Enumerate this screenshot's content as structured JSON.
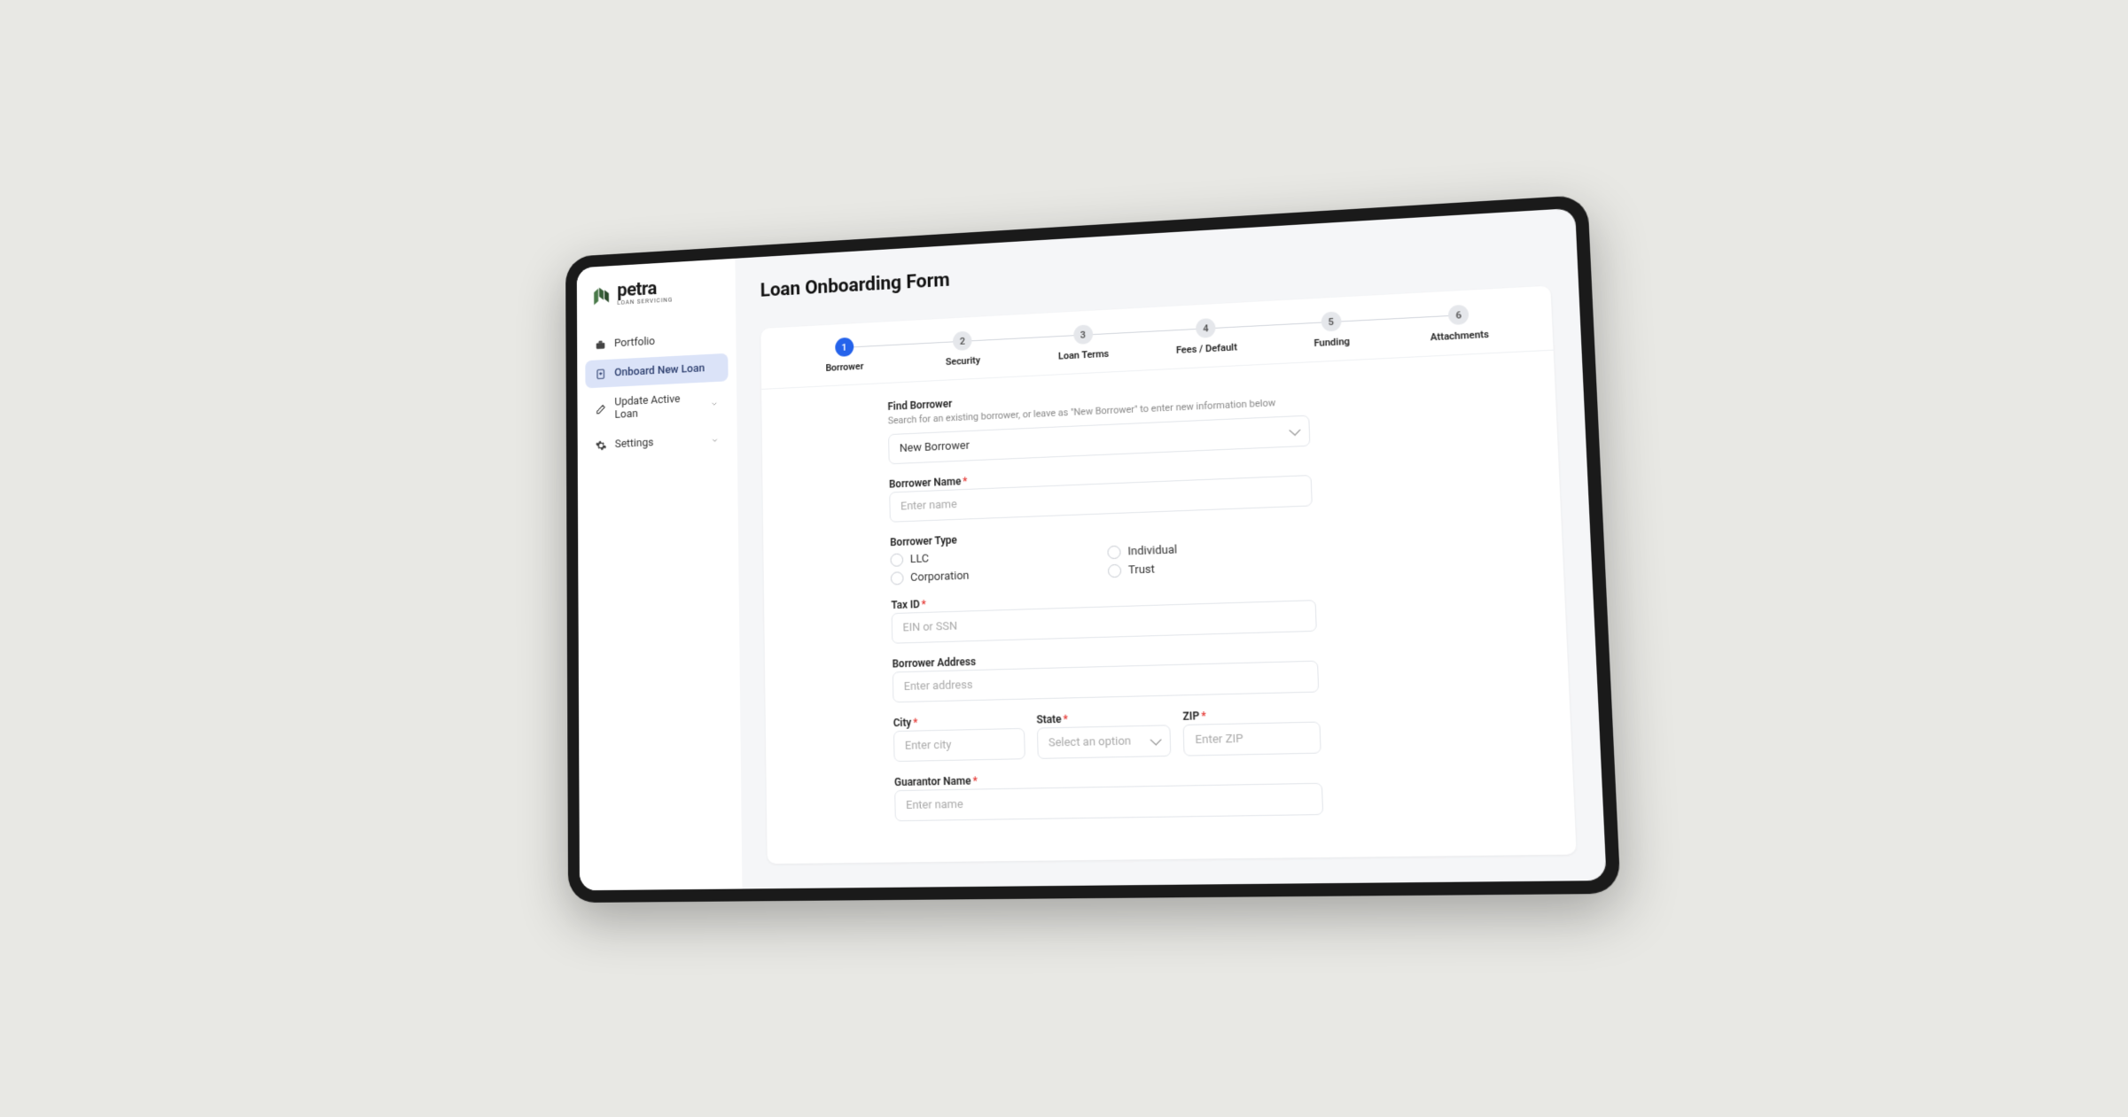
{
  "brand": {
    "name": "petra",
    "tagline": "LOAN SERVICING"
  },
  "nav": {
    "portfolio": "Portfolio",
    "onboard": "Onboard New Loan",
    "update": "Update Active Loan",
    "settings": "Settings"
  },
  "page": {
    "title": "Loan Onboarding Form"
  },
  "steps": [
    {
      "num": "1",
      "label": "Borrower"
    },
    {
      "num": "2",
      "label": "Security"
    },
    {
      "num": "3",
      "label": "Loan Terms"
    },
    {
      "num": "4",
      "label": "Fees / Default"
    },
    {
      "num": "5",
      "label": "Funding"
    },
    {
      "num": "6",
      "label": "Attachments"
    }
  ],
  "form": {
    "findBorrower": {
      "label": "Find Borrower",
      "help": "Search for an existing borrower, or leave as \"New Borrower\" to enter new information below",
      "value": "New Borrower"
    },
    "borrowerName": {
      "label": "Borrower Name",
      "placeholder": "Enter name"
    },
    "borrowerType": {
      "label": "Borrower Type",
      "options": {
        "llc": "LLC",
        "individual": "Individual",
        "corporation": "Corporation",
        "trust": "Trust"
      }
    },
    "taxId": {
      "label": "Tax ID",
      "placeholder": "EIN or SSN"
    },
    "borrowerAddress": {
      "label": "Borrower Address",
      "placeholder": "Enter address"
    },
    "city": {
      "label": "City",
      "placeholder": "Enter city"
    },
    "state": {
      "label": "State",
      "placeholder": "Select an option"
    },
    "zip": {
      "label": "ZIP",
      "placeholder": "Enter ZIP"
    },
    "guarantorName": {
      "label": "Guarantor Name",
      "placeholder": "Enter name"
    }
  }
}
